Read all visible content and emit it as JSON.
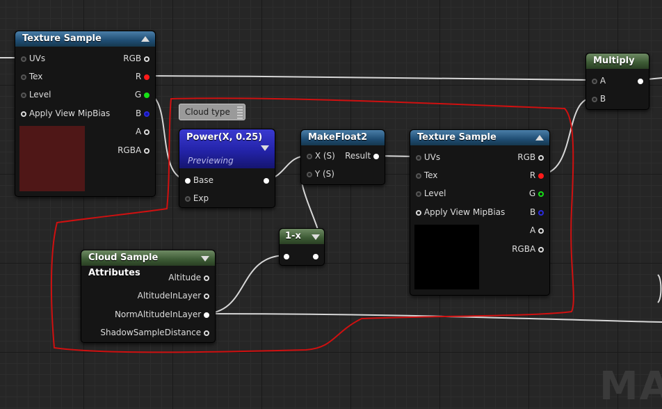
{
  "nodes": {
    "texture_sample_1": {
      "title": "Texture Sample",
      "inputs": [
        "UVs",
        "Tex",
        "Level",
        "Apply View MipBias"
      ],
      "outputs": [
        "RGB",
        "R",
        "G",
        "B",
        "A",
        "RGBA"
      ],
      "preview_color": "#4f1717"
    },
    "power": {
      "title": "Power(X, 0.25)",
      "subtitle": "Previewing",
      "inputs": [
        "Base",
        "Exp"
      ]
    },
    "makefloat2": {
      "title": "MakeFloat2",
      "inputs": [
        "X (S)",
        "Y (S)"
      ],
      "output": "Result"
    },
    "texture_sample_2": {
      "title": "Texture Sample",
      "inputs": [
        "UVs",
        "Tex",
        "Level",
        "Apply View MipBias"
      ],
      "outputs": [
        "RGB",
        "R",
        "G",
        "B",
        "A",
        "RGBA"
      ],
      "preview_color": "#000000"
    },
    "one_minus": {
      "title": "1-x"
    },
    "cloud_attrs": {
      "title": "Cloud Sample Attributes",
      "outputs": [
        "Altitude",
        "AltitudeInLayer",
        "NormAltitudeInLayer",
        "ShadowSampleDistance"
      ]
    },
    "multiply": {
      "title": "Multiply",
      "inputs": [
        "A",
        "B"
      ]
    }
  },
  "comment": {
    "text": "Cloud type"
  },
  "watermark": "MA",
  "colors": {
    "header_blue": "#1f4d73",
    "header_green": "#3c5a34",
    "power_header": "#2323a8",
    "highlight_stroke": "#d01010",
    "wire": "#d8d8d8"
  }
}
